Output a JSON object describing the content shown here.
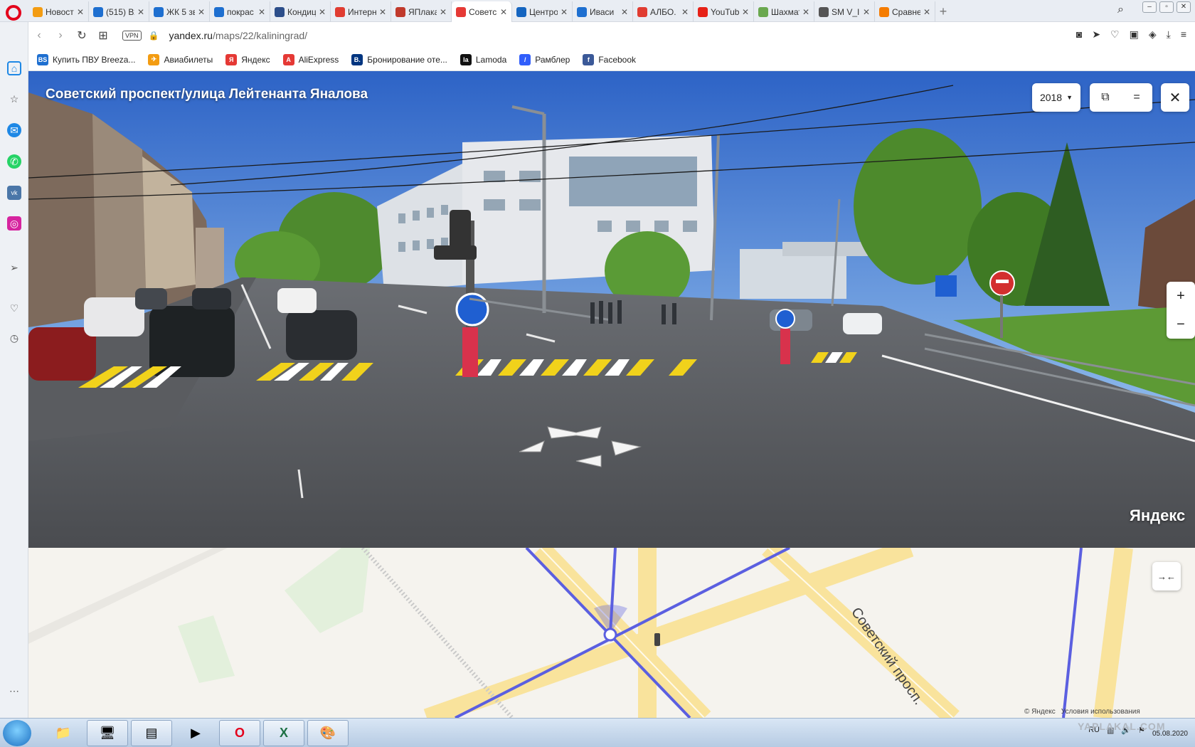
{
  "tabs": [
    {
      "label": "Новост",
      "color": "#f39c12"
    },
    {
      "label": "(515) Вх",
      "color": "#1e6fd0"
    },
    {
      "label": "ЖК 5 зв",
      "color": "#1e6fd0"
    },
    {
      "label": "покрас",
      "color": "#1e6fd0"
    },
    {
      "label": "Кондиц",
      "color": "#2c4e8a"
    },
    {
      "label": "Интерн",
      "color": "#e03c31"
    },
    {
      "label": "ЯПлака",
      "color": "#c0392b"
    },
    {
      "label": "Советс",
      "color": "#e53935",
      "active": true
    },
    {
      "label": "Центро",
      "color": "#1565c0"
    },
    {
      "label": "Иваси",
      "color": "#1e6fd0"
    },
    {
      "label": "АЛБО.",
      "color": "#e03c31"
    },
    {
      "label": "YouTub",
      "color": "#e62117"
    },
    {
      "label": "Шахмат",
      "color": "#6aa84f"
    },
    {
      "label": "SM V_II",
      "color": "#555555"
    },
    {
      "label": "Сравне",
      "color": "#f57c00"
    }
  ],
  "address": {
    "vpn": "VPN",
    "host": "yandex.ru",
    "path": "/maps/22/kaliningrad/"
  },
  "bookmarks": [
    {
      "label": "Купить ПВУ Breeza...",
      "icon_text": "BS",
      "color": "#1e6fd0"
    },
    {
      "label": "Авиабилеты",
      "icon_text": "✈",
      "color": "#f39c12"
    },
    {
      "label": "Яндекс",
      "icon_text": "Я",
      "color": "#e53935"
    },
    {
      "label": "AliExpress",
      "icon_text": "A",
      "color": "#e53935"
    },
    {
      "label": "Бронирование оте...",
      "icon_text": "B.",
      "color": "#003580"
    },
    {
      "label": "Lamoda",
      "icon_text": "la",
      "color": "#111111"
    },
    {
      "label": "Рамблер",
      "icon_text": "/",
      "color": "#315efb"
    },
    {
      "label": "Facebook",
      "icon_text": "f",
      "color": "#3b5998"
    }
  ],
  "panorama": {
    "title": "Советский проспект/улица Лейтенанта Яналова",
    "year": "2018",
    "watermark": "Яндекс"
  },
  "map": {
    "road_label": "Советский просп.",
    "copyright": "© Яндекс",
    "terms": "Условия использования"
  },
  "taskbar": {
    "lang": "RU",
    "date": "05.08.2020"
  },
  "watermark": "YAPLAKAL.COM"
}
